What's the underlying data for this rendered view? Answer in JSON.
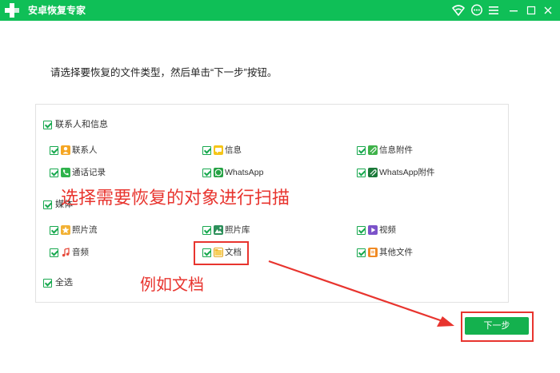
{
  "titlebar": {
    "title": "安卓恢复专家",
    "bg_color": "#0fbf57",
    "icons": [
      "plus-logo-icon",
      "wifi-icon",
      "chat-icon",
      "menu-icon",
      "minimize-icon",
      "maximize-icon",
      "close-icon"
    ]
  },
  "instruction": "请选择要恢复的文件类型，然后单击“下一步”按钮。",
  "groups": {
    "contacts": {
      "label": "联系人和信息",
      "items": [
        {
          "label": "联系人",
          "icon": "contact-icon",
          "color": "#f5a623"
        },
        {
          "label": "信息",
          "icon": "message-icon",
          "color": "#f5c518"
        },
        {
          "label": "信息附件",
          "icon": "attachment-icon",
          "color": "#3fb24a"
        },
        {
          "label": "通话记录",
          "icon": "phone-icon",
          "color": "#2fb34c"
        },
        {
          "label": "WhatsApp",
          "icon": "whatsapp-icon",
          "color": "#25a244"
        },
        {
          "label": "WhatsApp附件",
          "icon": "whatsapp-attachment-icon",
          "color": "#1c7a3a"
        }
      ]
    },
    "media": {
      "label": "媒体",
      "items": [
        {
          "label": "照片流",
          "icon": "photo-stream-icon",
          "color": "#f2b134"
        },
        {
          "label": "照片库",
          "icon": "photo-library-icon",
          "color": "#2c8f5a"
        },
        {
          "label": "视频",
          "icon": "video-icon",
          "color": "#7b52c9"
        },
        {
          "label": "音频",
          "icon": "audio-icon",
          "color": "#e64a3b"
        },
        {
          "label": "文档",
          "icon": "document-icon",
          "color": "#f0b429"
        },
        {
          "label": "其他文件",
          "icon": "other-files-icon",
          "color": "#f08a24"
        }
      ]
    }
  },
  "select_all": "全选",
  "next_button": "下一步",
  "annotations": {
    "main": "选择需要恢复的对象进行扫描",
    "example": "例如文档",
    "color": "#e8342e"
  },
  "accent_color": "#14b14e"
}
